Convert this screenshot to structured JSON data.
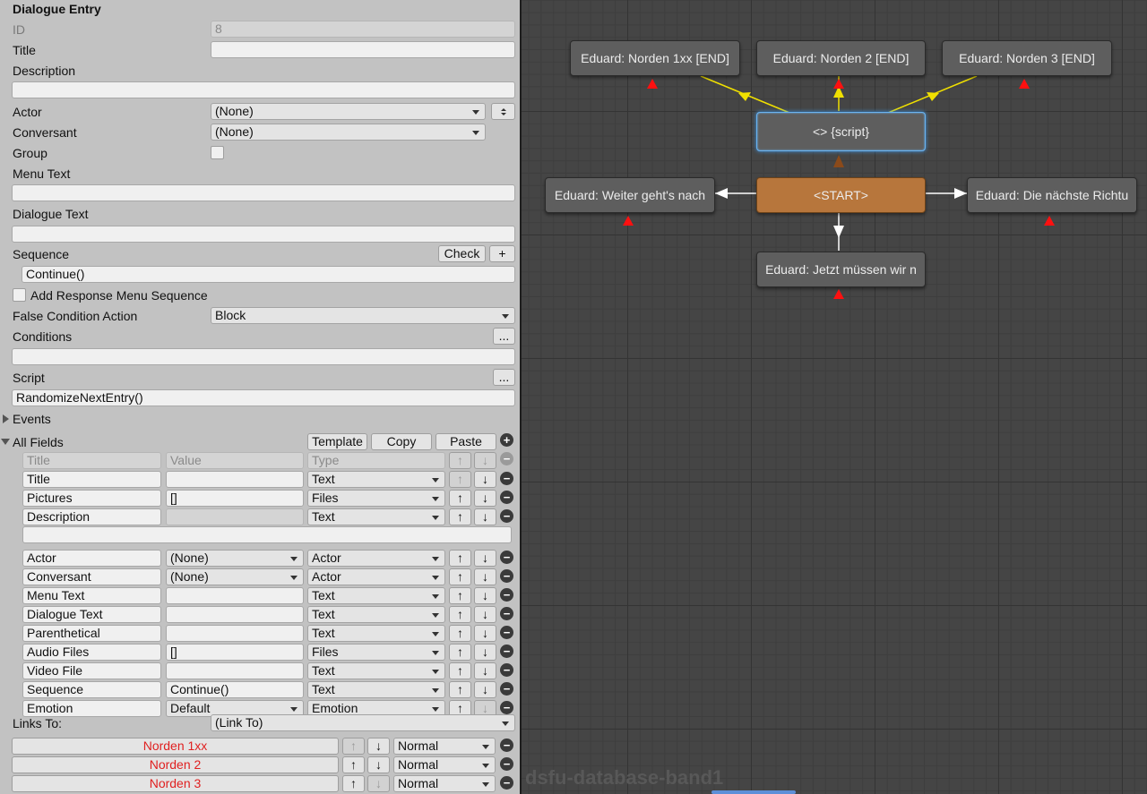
{
  "inspector": {
    "header": "Dialogue Entry",
    "id_label": "ID",
    "id_value": "8",
    "title_label": "Title",
    "title_value": "",
    "description_label": "Description",
    "description_value": "",
    "actor_label": "Actor",
    "actor_value": "(None)",
    "conversant_label": "Conversant",
    "conversant_value": "(None)",
    "group_label": "Group",
    "menu_text_label": "Menu Text",
    "menu_text_value": "",
    "dialogue_text_label": "Dialogue Text",
    "dialogue_text_value": "",
    "sequence_label": "Sequence",
    "check_button": "Check",
    "plus_button": "+",
    "sequence_value": "Continue()",
    "add_response_label": "Add Response Menu Sequence",
    "false_condition_label": "False Condition Action",
    "false_condition_value": "Block",
    "conditions_label": "Conditions",
    "ellipsis": "...",
    "conditions_value": "",
    "script_label": "Script",
    "script_value": "RandomizeNextEntry()",
    "events_label": "Events",
    "all_fields_label": "All Fields",
    "template_button": "Template",
    "copy_button": "Copy",
    "paste_button": "Paste",
    "add_symbol": "+",
    "remove_symbol": "−",
    "up_arrow": "↑",
    "down_arrow": "↓",
    "header_row": {
      "title": "Title",
      "value": "Value",
      "type": "Type"
    },
    "fields": [
      {
        "title": "Title",
        "value": "",
        "value_kind": "text",
        "type": "Text"
      },
      {
        "title": "Pictures",
        "value": "[]",
        "value_kind": "text",
        "type": "Files"
      },
      {
        "title": "Description",
        "value": "",
        "value_kind": "disabled",
        "type": "Text",
        "has_extra_line": true
      },
      {
        "title": "Actor",
        "value": "(None)",
        "value_kind": "dropdown",
        "type": "Actor"
      },
      {
        "title": "Conversant",
        "value": "(None)",
        "value_kind": "dropdown",
        "type": "Actor"
      },
      {
        "title": "Menu Text",
        "value": "",
        "value_kind": "text",
        "type": "Text"
      },
      {
        "title": "Dialogue Text",
        "value": "",
        "value_kind": "text",
        "type": "Text"
      },
      {
        "title": "Parenthetical",
        "value": "",
        "value_kind": "text",
        "type": "Text"
      },
      {
        "title": "Audio Files",
        "value": "[]",
        "value_kind": "text",
        "type": "Files"
      },
      {
        "title": "Video File",
        "value": "",
        "value_kind": "text",
        "type": "Text"
      },
      {
        "title": "Sequence",
        "value": "Continue()",
        "value_kind": "text",
        "type": "Text"
      },
      {
        "title": "Emotion",
        "value": "Default",
        "value_kind": "dropdown",
        "type": "Emotion"
      }
    ],
    "links_to_label": "Links To:",
    "links_to_value": "(Link To)",
    "links": [
      {
        "name": "Norden 1xx",
        "priority": "Normal"
      },
      {
        "name": "Norden 2",
        "priority": "Normal"
      },
      {
        "name": "Norden 3",
        "priority": "Normal"
      }
    ]
  },
  "graph": {
    "watermark": "dsfu-database-band1",
    "nodes": {
      "norden1": "Eduard: Norden 1xx [END]",
      "norden2": "Eduard: Norden 2 [END]",
      "norden3": "Eduard: Norden 3 [END]",
      "script": "<> {script}",
      "start": "<START>",
      "weiter": "Eduard: Weiter geht's nach",
      "naechste": "Eduard: Die nächste Richtu",
      "jetzt": "Eduard: Jetzt müssen wir n"
    },
    "colors": {
      "canvas": "#454545",
      "node": "#5e5e5e",
      "start_node": "#b7763c",
      "selection": "#6ab4f2",
      "arrow_yellow": "#f0e000",
      "arrow_white": "#ffffff",
      "arrow_brown": "#8b4a1a",
      "warning_red": "#ff1010",
      "link_red": "#e02020"
    }
  }
}
